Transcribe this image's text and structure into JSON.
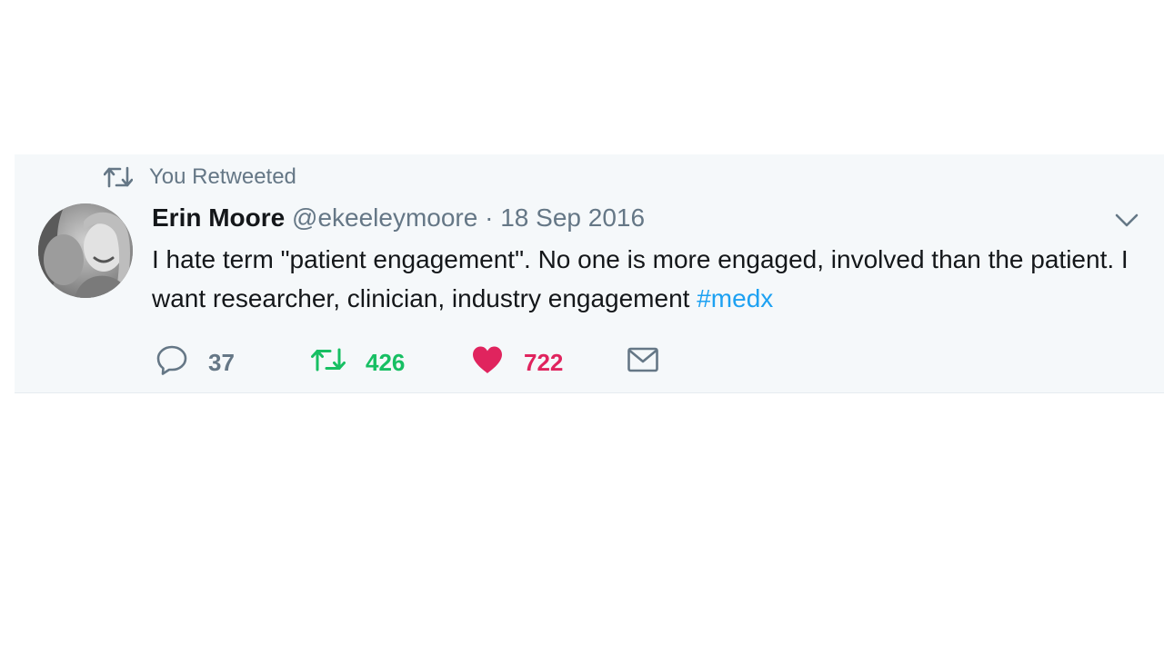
{
  "retweet_context": {
    "label": "You Retweeted",
    "icon": "retweet-icon"
  },
  "tweet": {
    "author_name": "Erin Moore",
    "author_handle": "@ekeeleymoore",
    "separator": "·",
    "date": "18 Sep 2016",
    "text": "I hate term \"patient engagement\". No one is more engaged, involved than the patient. I want researcher, clinician, industry engagement ",
    "hashtag": "#medx",
    "avatar_icon": "profile-photo",
    "menu_icon": "chevron-down-icon"
  },
  "actions": {
    "reply": {
      "icon": "reply-icon",
      "count": "37",
      "color": "#657786"
    },
    "retweet": {
      "icon": "retweet-icon",
      "count": "426",
      "color": "#17bf63",
      "active": true
    },
    "like": {
      "icon": "heart-icon",
      "count": "722",
      "color": "#e0245e",
      "active": true
    },
    "message": {
      "icon": "envelope-icon"
    }
  },
  "colors": {
    "background": "#f5f8fa",
    "text": "#14171a",
    "secondary": "#657786",
    "link": "#1da1f2"
  }
}
